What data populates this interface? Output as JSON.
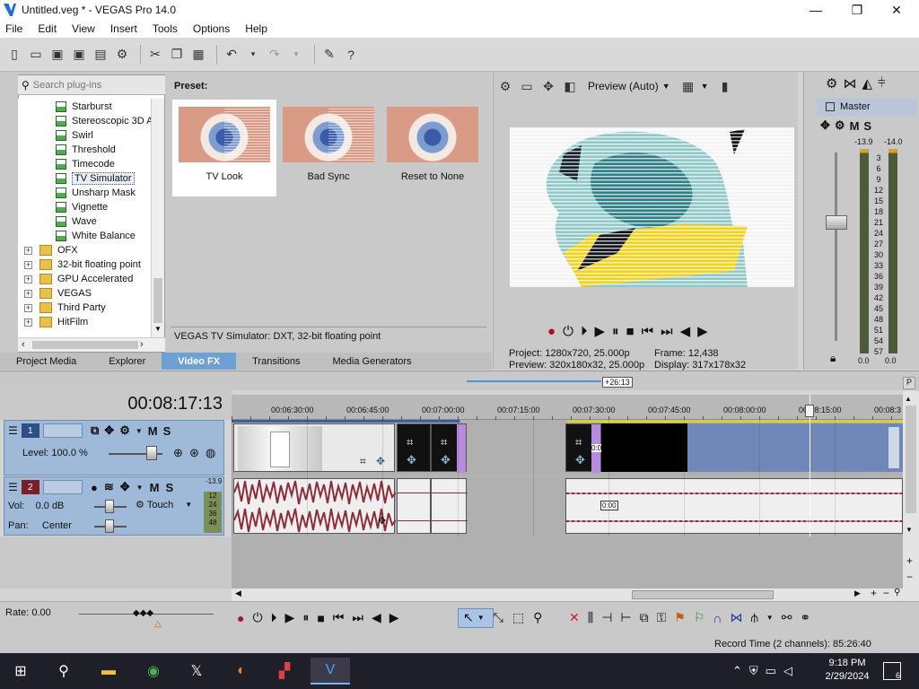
{
  "window": {
    "title": "Untitled.veg * - VEGAS Pro 14.0",
    "minimize_glyph": "—",
    "maximize_glyph": "❐",
    "close_glyph": "✕"
  },
  "menu": [
    "File",
    "Edit",
    "View",
    "Insert",
    "Tools",
    "Options",
    "Help"
  ],
  "plugins": {
    "search_placeholder": "Search plug-ins",
    "effects": [
      "Starburst",
      "Stereoscopic 3D A",
      "Swirl",
      "Threshold",
      "Timecode",
      "TV Simulator",
      "Unsharp Mask",
      "Vignette",
      "Wave",
      "White Balance"
    ],
    "selected_effect": "TV Simulator",
    "folders": [
      "OFX",
      "32-bit floating point",
      "GPU Accelerated",
      "VEGAS",
      "Third Party",
      "HitFilm"
    ],
    "preset_heading": "Preset:",
    "presets": [
      "TV Look",
      "Bad Sync",
      "Reset to None"
    ],
    "description": "VEGAS TV Simulator: DXT, 32-bit floating point"
  },
  "tabs": [
    "Project Media",
    "Explorer",
    "Video FX",
    "Transitions",
    "Media Generators"
  ],
  "active_tab": "Video FX",
  "preview": {
    "mode": "Preview (Auto)",
    "project_label": "Project:",
    "project_value": "1280x720, 25.000p",
    "preview_label": "Preview:",
    "preview_value": "320x180x32, 25.000p",
    "frame_label": "Frame:",
    "frame_value": "12,438",
    "display_label": "Display:",
    "display_value": "317x178x32"
  },
  "master": {
    "label": "Master",
    "m_label": "M",
    "s_label": "S",
    "peak_left": "-13.9",
    "peak_right": "-14.0",
    "scale": [
      "3",
      "6",
      "9",
      "12",
      "15",
      "18",
      "21",
      "24",
      "27",
      "30",
      "33",
      "36",
      "39",
      "42",
      "45",
      "48",
      "51",
      "54",
      "57"
    ],
    "out_left": "0.0",
    "out_right": "0.0"
  },
  "timeline": {
    "timecode": "00:08:17:13",
    "loop_badge": "+26:13",
    "ruler": [
      "00:06:30:00",
      "00:06:45:00",
      "00:07:00:00",
      "00:07:15:00",
      "00:07:30:00",
      "00:07:45:00",
      "00:08:00:00",
      "00:08:15:00",
      "00:08:3"
    ],
    "clip_time_1": "0:00",
    "clip_time_2": "0:00"
  },
  "video_track": {
    "number": "1",
    "level_label": "Level:",
    "level_value": "100.0 %",
    "m": "M",
    "s": "S"
  },
  "audio_track": {
    "number": "2",
    "vol_label": "Vol:",
    "vol_value": "0.0 dB",
    "pan_label": "Pan:",
    "pan_value": "Center",
    "automation": "Touch",
    "peak": "-13.9",
    "meter_scale": [
      "12",
      "24",
      "36",
      "48"
    ],
    "m": "M",
    "s": "S"
  },
  "transport": {
    "rate": "Rate: 0.00"
  },
  "status": {
    "record_time": "Record Time (2 channels): 85:26:40"
  },
  "taskbar": {
    "time": "9:18 PM",
    "date": "2/29/2024",
    "notifications": "6"
  },
  "colors": {
    "track_header": "#9fb9d8",
    "audio_wave": "#8c2d3a",
    "active_tab": "#6ea0d4",
    "selection_blue": "#6f88b8"
  }
}
